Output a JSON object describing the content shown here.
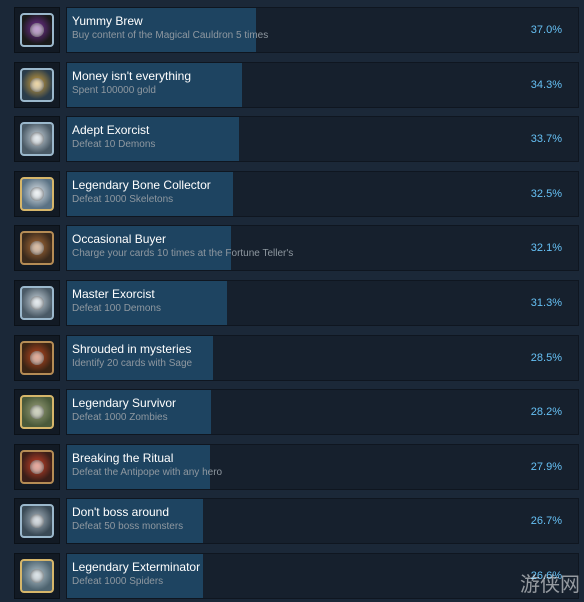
{
  "achievements": [
    {
      "title": "Yummy Brew",
      "desc": "Buy content of the Magical Cauldron 5 times",
      "pct": "37.0%",
      "value": 37.0,
      "icon": "cauldron-icon",
      "frame": "blue",
      "c1": "#7a2f9e",
      "c2": "#1a1a1a"
    },
    {
      "title": "Money isn't everything",
      "desc": "Spent 100000 gold",
      "pct": "34.3%",
      "value": 34.3,
      "icon": "winged-coin-icon",
      "frame": "blue",
      "c1": "#d8a53a",
      "c2": "#2a3c4a"
    },
    {
      "title": "Adept Exorcist",
      "desc": "Defeat 10 Demons",
      "pct": "33.7%",
      "value": 33.7,
      "icon": "demon-skull-icon",
      "frame": "blue",
      "c1": "#c9d4dc",
      "c2": "#4a5a66"
    },
    {
      "title": "Legendary Bone Collector",
      "desc": "Defeat 1000 Skeletons",
      "pct": "32.5%",
      "value": 32.5,
      "icon": "skull-icon",
      "frame": "gold",
      "c1": "#dfe4e8",
      "c2": "#5a7284"
    },
    {
      "title": "Occasional Buyer",
      "desc": "Charge your cards 10 times at the Fortune Teller's",
      "pct": "32.1%",
      "value": 32.1,
      "icon": "fortune-stand-icon",
      "frame": "bronze",
      "c1": "#b0703a",
      "c2": "#3a2a1c"
    },
    {
      "title": "Master Exorcist",
      "desc": "Defeat 100 Demons",
      "pct": "31.3%",
      "value": 31.3,
      "icon": "demon-skull-icon",
      "frame": "blue",
      "c1": "#c9d4dc",
      "c2": "#4a5a66"
    },
    {
      "title": "Shrouded in mysteries",
      "desc": "Identify 20 cards with Sage",
      "pct": "28.5%",
      "value": 28.5,
      "icon": "question-card-icon",
      "frame": "bronze",
      "c1": "#c24a22",
      "c2": "#3a2414"
    },
    {
      "title": "Legendary Survivor",
      "desc": "Defeat 1000 Zombies",
      "pct": "28.2%",
      "value": 28.2,
      "icon": "zombie-head-icon",
      "frame": "gold",
      "c1": "#9aa07a",
      "c2": "#4a5a3a"
    },
    {
      "title": "Breaking the Ritual",
      "desc": "Defeat the Antipope with any hero",
      "pct": "27.9%",
      "value": 27.9,
      "icon": "ritual-symbol-icon",
      "frame": "bronze",
      "c1": "#d0442a",
      "c2": "#3a1e18"
    },
    {
      "title": "Don't boss around",
      "desc": "Defeat 50 boss monsters",
      "pct": "26.7%",
      "value": 26.7,
      "icon": "axe-icon",
      "frame": "blue",
      "c1": "#aab6c0",
      "c2": "#3a4a56"
    },
    {
      "title": "Legendary Exterminator",
      "desc": "Defeat 1000 Spiders",
      "pct": "26.6%",
      "value": 26.6,
      "icon": "tombstone-icon",
      "frame": "gold",
      "c1": "#b4c4cc",
      "c2": "#4e6470"
    }
  ],
  "watermark": "游侠网"
}
